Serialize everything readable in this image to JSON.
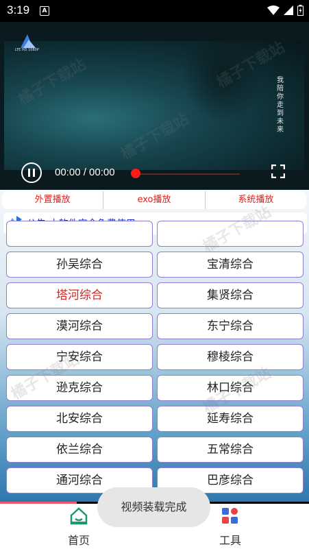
{
  "status_bar": {
    "time": "3:19",
    "notification_icon": "A"
  },
  "video": {
    "logo_text": "LTE HD 1080P",
    "watermark_text": "橘子下载站",
    "overlay_text": "我陪你走到未来",
    "time_display": "00:00 / 00:00",
    "progress": 0
  },
  "mode_tabs": [
    {
      "label": "外置播放"
    },
    {
      "label": "exo播放"
    },
    {
      "label": "系统播放"
    }
  ],
  "notice": {
    "text": "公告:本软件完全免费使用"
  },
  "channels": [
    {
      "left": "孙吴综合",
      "right": "宝清综合"
    },
    {
      "left": "塔河综合",
      "right": "集贤综合"
    },
    {
      "left": "漠河综合",
      "right": "东宁综合"
    },
    {
      "left": "宁安综合",
      "right": "穆棱综合"
    },
    {
      "left": "逊克综合",
      "right": "林口综合"
    },
    {
      "left": "北安综合",
      "right": "延寿综合"
    },
    {
      "left": "依兰综合",
      "right": "五常综合"
    },
    {
      "left": "通河综合",
      "right": "巴彦综合"
    }
  ],
  "selected_channel": "塔河综合",
  "toast": {
    "text": "视频装载完成"
  },
  "nav": {
    "home_label": "首页",
    "tools_label": "工具"
  },
  "colors": {
    "accent_red": "#e0201a",
    "notice_blue": "#1133d0",
    "cell_border": "#8f7ed0"
  }
}
